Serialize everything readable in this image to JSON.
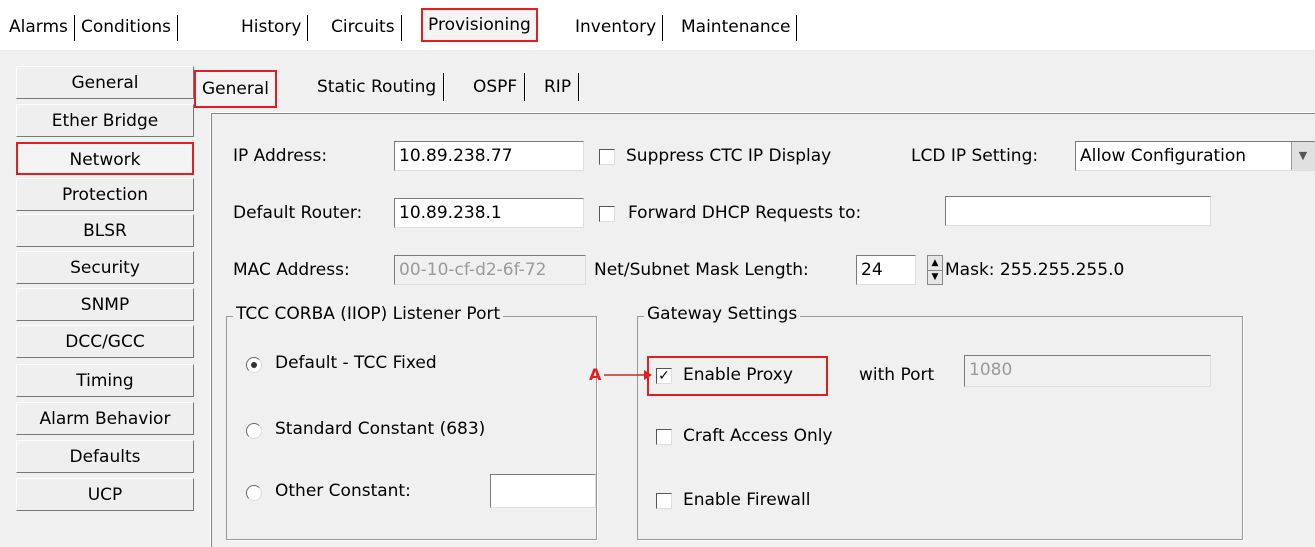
{
  "top_tabs": [
    "Alarms",
    "Conditions",
    "History",
    "Circuits",
    "Provisioning",
    "Inventory",
    "Maintenance"
  ],
  "left_nav": [
    "General",
    "Ether Bridge",
    "Network",
    "Protection",
    "BLSR",
    "Security",
    "SNMP",
    "DCC/GCC",
    "Timing",
    "Alarm Behavior",
    "Defaults",
    "UCP"
  ],
  "sub_tabs": [
    "General",
    "Static Routing",
    "OSPF",
    "RIP"
  ],
  "network": {
    "ip_label": "IP Address:",
    "ip_value": "10.89.238.77",
    "suppress_label": "Suppress CTC IP Display",
    "lcd_label": "LCD IP Setting:",
    "lcd_value": "Allow Configuration",
    "router_label": "Default Router:",
    "router_value": "10.89.238.1",
    "dhcp_label": "Forward DHCP Requests to:",
    "dhcp_value": "",
    "mac_label": "MAC Address:",
    "mac_value": "00-10-cf-d2-6f-72",
    "mask_len_label": "Net/Subnet Mask Length:",
    "mask_len_value": "24",
    "mask_label": "Mask: 255.255.255.0"
  },
  "corba": {
    "title": "TCC CORBA (IIOP) Listener Port",
    "opt_default": "Default - TCC Fixed",
    "opt_standard": "Standard Constant (683)",
    "opt_other": "Other Constant:",
    "other_value": ""
  },
  "gateway": {
    "title": "Gateway Settings",
    "enable_proxy": "Enable Proxy",
    "with_port": "with Port",
    "port_value": "1080",
    "craft_access": "Craft Access Only",
    "enable_firewall": "Enable Firewall"
  },
  "annotation": {
    "label": "A",
    "color": "#e02020"
  }
}
